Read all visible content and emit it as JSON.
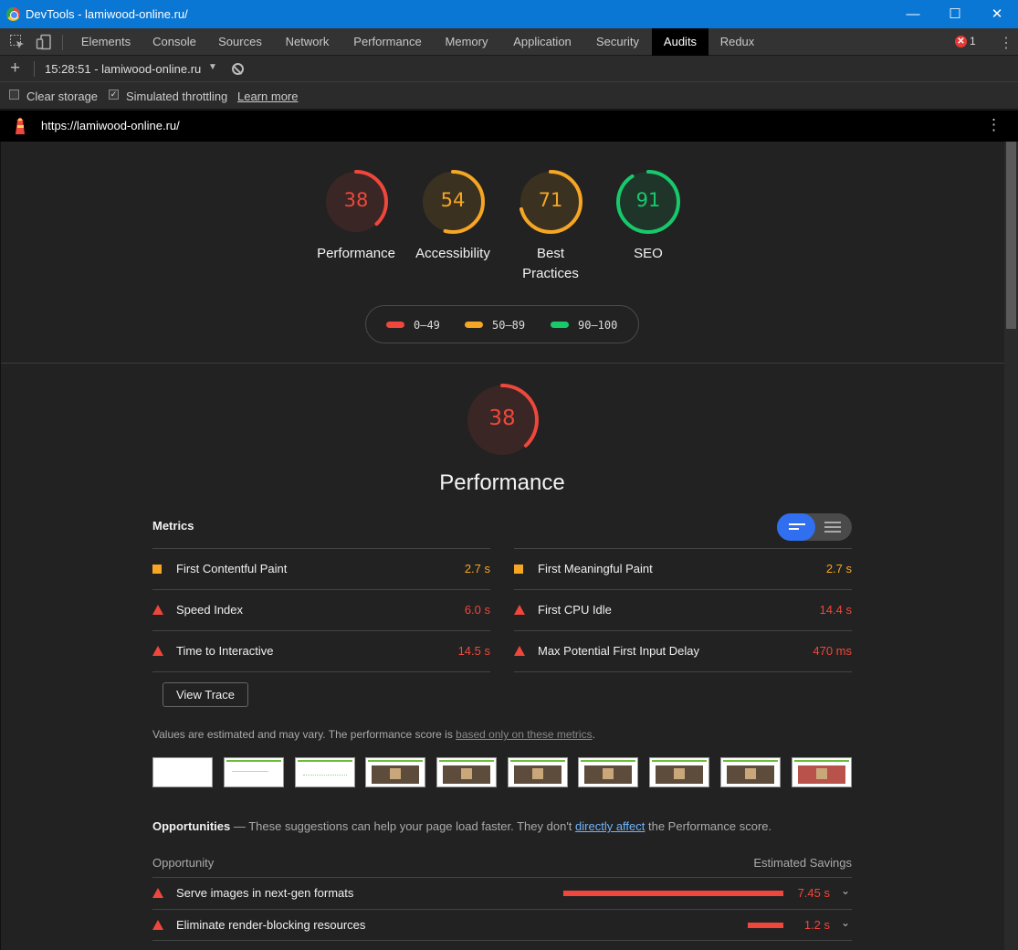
{
  "window": {
    "title": "DevTools - lamiwood-online.ru/",
    "minimize": "—",
    "maximize": "☐",
    "close": "✕"
  },
  "tabs": [
    "Elements",
    "Console",
    "Sources",
    "Network",
    "Performance",
    "Memory",
    "Application",
    "Security",
    "Audits",
    "Redux"
  ],
  "active_tab": "Audits",
  "errors": {
    "count": "1"
  },
  "run": {
    "report_label": "15:28:51 - lamiwood-online.ru"
  },
  "options": {
    "clear_storage": "Clear storage",
    "throttling": "Simulated throttling",
    "learn_more": "Learn more"
  },
  "url": "https://lamiwood-online.ru/",
  "scores": [
    {
      "value": "38",
      "label": "Performance",
      "color": "#f0473c"
    },
    {
      "value": "54",
      "label": "Accessibility",
      "color": "#f5a623"
    },
    {
      "value": "71",
      "label": "Best Practices",
      "color": "#f5a623"
    },
    {
      "value": "91",
      "label": "SEO",
      "color": "#18c96b"
    }
  ],
  "legend": [
    {
      "range": "0–49",
      "color": "#f0473c"
    },
    {
      "range": "50–89",
      "color": "#f5a623"
    },
    {
      "range": "90–100",
      "color": "#18c96b"
    }
  ],
  "performance": {
    "score": "38",
    "title": "Performance",
    "metrics_title": "Metrics",
    "metrics": [
      {
        "name": "First Contentful Paint",
        "value": "2.7 s",
        "status": "average"
      },
      {
        "name": "First Meaningful Paint",
        "value": "2.7 s",
        "status": "average"
      },
      {
        "name": "Speed Index",
        "value": "6.0 s",
        "status": "fail"
      },
      {
        "name": "First CPU Idle",
        "value": "14.4 s",
        "status": "fail"
      },
      {
        "name": "Time to Interactive",
        "value": "14.5 s",
        "status": "fail"
      },
      {
        "name": "Max Potential First Input Delay",
        "value": "470 ms",
        "status": "fail"
      }
    ],
    "view_trace": "View Trace",
    "note_prefix": "Values are estimated and may vary. The performance score is ",
    "note_link": "based only on these metrics",
    "note_suffix": "."
  },
  "opportunities": {
    "title": "Opportunities",
    "desc_prefix": " — These suggestions can help your page load faster. They don't ",
    "desc_link": "directly affect",
    "desc_suffix": " the Performance score.",
    "col_left": "Opportunity",
    "col_right": "Estimated Savings",
    "items": [
      {
        "name": "Serve images in next-gen formats",
        "value": "7.45 s",
        "bar_fraction": 1.0
      },
      {
        "name": "Eliminate render-blocking resources",
        "value": "1.2 s",
        "bar_fraction": 0.16
      }
    ]
  },
  "colors": {
    "fail": "#f0473c",
    "average": "#f5a623",
    "pass": "#18c96b",
    "accent": "#2f6ff0"
  }
}
